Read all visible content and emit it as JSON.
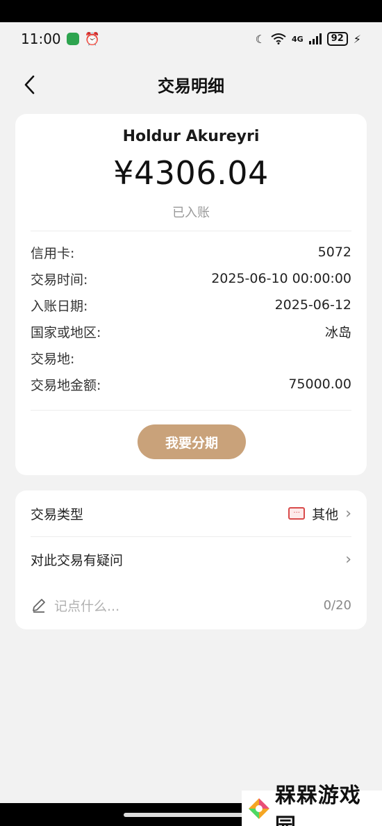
{
  "status_bar": {
    "time": "11:00",
    "network": "4G",
    "battery": "92"
  },
  "header": {
    "title": "交易明细"
  },
  "transaction": {
    "merchant": "Holdur Akureyri",
    "amount": "¥4306.04",
    "status": "已入账",
    "details": [
      {
        "label": "信用卡:",
        "value": "5072"
      },
      {
        "label": "交易时间:",
        "value": "2025-06-10 00:00:00"
      },
      {
        "label": "入账日期:",
        "value": "2025-06-12"
      },
      {
        "label": "国家或地区:",
        "value": "冰岛"
      },
      {
        "label": "交易地:",
        "value": ""
      },
      {
        "label": "交易地金额:",
        "value": "75000.00"
      }
    ],
    "installment_button": "我要分期"
  },
  "extra": {
    "type_label": "交易类型",
    "type_value": "其他",
    "type_icon": "category-other-icon",
    "dispute_label": "对此交易有疑问",
    "note_placeholder": "记点什么...",
    "note_counter": "0/20"
  },
  "watermark": {
    "text": "槑槑游戏园"
  },
  "colors": {
    "accent": "#c9a27a",
    "background": "#f2f2f2",
    "card": "#ffffff",
    "category_icon": "#d94a4a"
  }
}
